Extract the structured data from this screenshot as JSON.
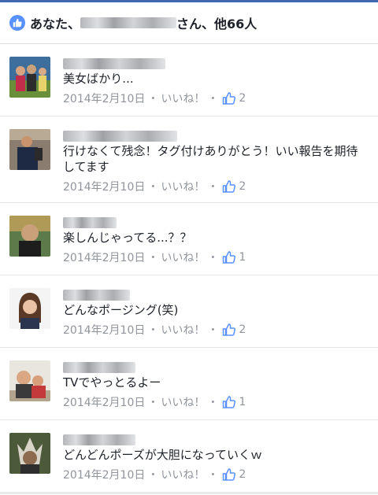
{
  "header": {
    "prefix": "あなた、",
    "suffix": "さん、他66人"
  },
  "comments": [
    {
      "text": "美女ばかり...",
      "date": "2014年2月10日",
      "like_label": "いいね！",
      "count": "2"
    },
    {
      "text": "行けなくて残念！タグ付けありがとう！いい報告を期待してます",
      "date": "2014年2月10日",
      "like_label": "いいね！",
      "count": "2"
    },
    {
      "text": "楽しんじゃってる...？？",
      "date": "2014年2月10日",
      "like_label": "いいね！",
      "count": "1"
    },
    {
      "text": "どんなポージング(笑)",
      "date": "2014年2月10日",
      "like_label": "いいね！",
      "count": "2"
    },
    {
      "text": "TVでやっとるよー",
      "date": "2014年2月10日",
      "like_label": "いいね！",
      "count": "1"
    },
    {
      "text": "どんどんポーズが大胆になっていくｗ",
      "date": "2014年2月10日",
      "like_label": "いいね！",
      "count": "2"
    }
  ],
  "colors": {
    "accent": "#4267b2",
    "like_blue": "#5890ff",
    "meta_gray": "#90949c"
  },
  "icons": {
    "header": "thumbs-up-icon",
    "meta": "thumbs-up-icon"
  }
}
